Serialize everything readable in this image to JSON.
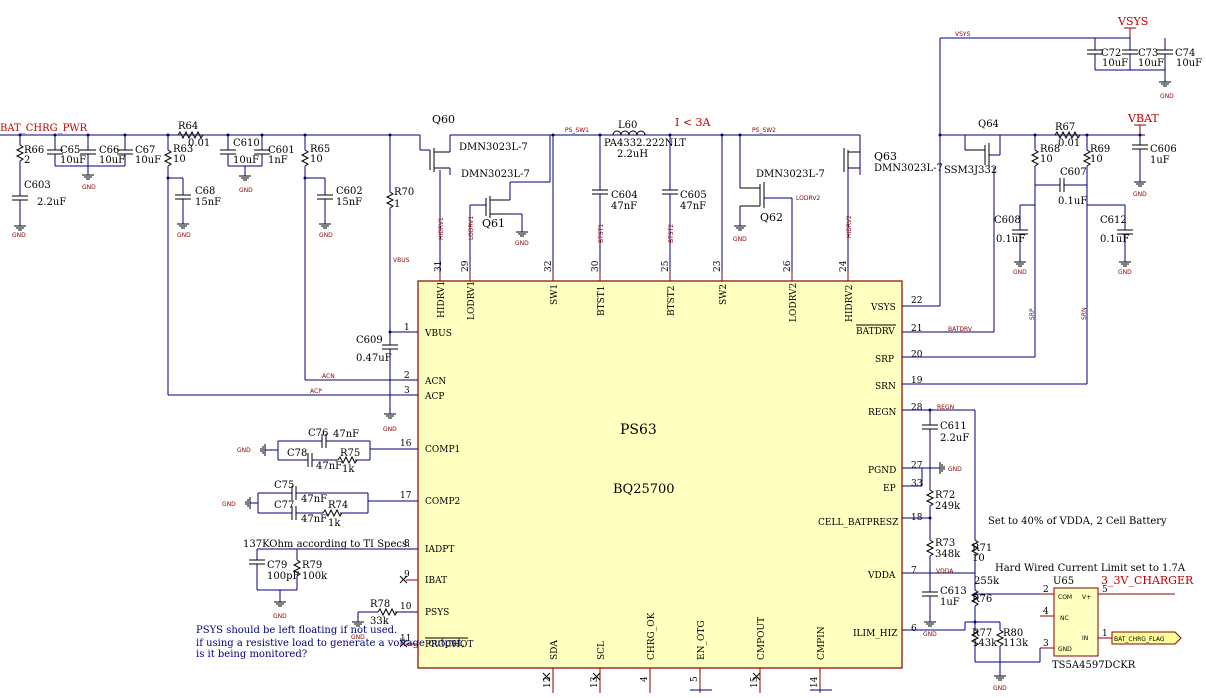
{
  "chip": {
    "designator": "PS63",
    "part": "BQ25700",
    "pins_top": [
      {
        "name": "HIDRV1",
        "num": "31"
      },
      {
        "name": "LODRV1",
        "num": "29"
      },
      {
        "name": "SW1",
        "num": "32"
      },
      {
        "name": "BTST1",
        "num": "30"
      },
      {
        "name": "BTST2",
        "num": "25"
      },
      {
        "name": "SW2",
        "num": "23"
      },
      {
        "name": "LODRV2",
        "num": "26"
      },
      {
        "name": "HIDRV2",
        "num": "24"
      }
    ],
    "pins_left": [
      {
        "name": "VBUS",
        "num": "1"
      },
      {
        "name": "ACN",
        "num": "2"
      },
      {
        "name": "ACP",
        "num": "3"
      },
      {
        "name": "COMP1",
        "num": "16"
      },
      {
        "name": "COMP2",
        "num": "17"
      },
      {
        "name": "IADPT",
        "num": "8"
      },
      {
        "name": "IBAT",
        "num": "9"
      },
      {
        "name": "PSYS",
        "num": "10"
      },
      {
        "name": "PROCHOT",
        "num": "11"
      }
    ],
    "pins_right": [
      {
        "name": "VSYS",
        "num": "22"
      },
      {
        "name": "BATDRV",
        "num": "21"
      },
      {
        "name": "SRP",
        "num": "20"
      },
      {
        "name": "SRN",
        "num": "19"
      },
      {
        "name": "REGN",
        "num": "28"
      },
      {
        "name": "PGND",
        "num": "27"
      },
      {
        "name": "EP",
        "num": "33"
      },
      {
        "name": "CELL_BATPRESZ",
        "num": "18"
      },
      {
        "name": "VDDA",
        "num": "7"
      },
      {
        "name": "ILIM_HIZ",
        "num": "6"
      }
    ],
    "pins_bottom": [
      {
        "name": "SDA",
        "num": "12"
      },
      {
        "name": "SCL",
        "num": "13"
      },
      {
        "name": "CHRG_OK",
        "num": "4"
      },
      {
        "name": "EN_OTG",
        "num": "5"
      },
      {
        "name": "CMPOUT",
        "num": "15"
      },
      {
        "name": "CMPIN",
        "num": "14"
      }
    ]
  },
  "ports": {
    "bat_chrg_pwr": "BAT_CHRG_PWR",
    "vsys": "VSYS",
    "vbat": "VBAT",
    "charger_3v": "3_3V_CHARGER",
    "bat_chrg_flag": "BAT_CHRG_FLAG"
  },
  "nets": {
    "ps_sw1": "PS_SW1",
    "ps_sw2": "PS_SW2",
    "vsys_top": "VSYS",
    "vbus": "VBUS",
    "acn": "ACN",
    "acp": "ACP",
    "hidrv1": "HIDRV1",
    "lodrv1": "LODRV1",
    "btst1": "BTST1",
    "btst2": "BTST2",
    "lodrv2": "LODRV2",
    "hidrv2": "HIDRV2",
    "batdrv": "BATDRV",
    "srp": "SRP",
    "srn": "SRN",
    "regn": "REGN",
    "vdda": "VDDA",
    "gnd": "GND"
  },
  "transistors": [
    {
      "ref": "Q60",
      "part": "DMN3023L-7"
    },
    {
      "ref": "Q61",
      "part": "DMN3023L-7"
    },
    {
      "ref": "Q62",
      "part": "DMN3023L-7"
    },
    {
      "ref": "Q63",
      "part": "DMN3023L-7"
    },
    {
      "ref": "Q64",
      "part": "SSM3J332"
    }
  ],
  "inductor": {
    "ref": "L60",
    "part": "PA4332.222NLT",
    "value": "2.2uH",
    "note": "I < 3A"
  },
  "capacitors": {
    "C65": "10uF",
    "C66": "10uF",
    "C67": "10uF",
    "C603": "2.2uF",
    "C610": "10uF",
    "C601": "1nF",
    "C68": "15nF",
    "C602": "15nF",
    "C604": "47nF",
    "C605": "47nF",
    "C609": "0.47uF",
    "C72": "10uF",
    "C73": "10uF",
    "C74": "10uF",
    "C606": "1uF",
    "C607": "0.1uF",
    "C608": "0.1uF",
    "C612": "0.1uF",
    "C611": "2.2uF",
    "C613": "1uF",
    "C76": "47nF",
    "C78": "47nF",
    "C75": "47nF",
    "C77": "47nF",
    "C79": "100pF"
  },
  "resistors": {
    "R66": "2",
    "R64": "0.01",
    "R63": "10",
    "R65": "10",
    "R70": "1",
    "R67": "0.01",
    "R68": "10",
    "R69": "10",
    "R72": "249k",
    "R73": "348k",
    "R71": "10",
    "R76": "255k",
    "R77": "143k",
    "R80": "113k",
    "R75": "1k",
    "R74": "1k",
    "R79": "100k",
    "R78": "33k"
  },
  "u65": {
    "ref": "U65",
    "part": "TS5A4597DCKR",
    "pins": [
      "COM",
      "V+",
      "NC",
      "IN",
      "GND"
    ],
    "pin_nums": [
      "2",
      "5",
      "4",
      "1",
      "3"
    ]
  },
  "notes": {
    "vdda_note": "Set to 40% of VDDA, 2 Cell Battery",
    "ilim_note": "Hard Wired Current Limit set to 1.7A",
    "iadpt_note": "137KOhm according to TI Specs.",
    "psys_note": "PSYS should be left floating if not used.",
    "psys_note2": "if using a resistive load to generate a voltage output,",
    "psys_note3": "is it being monitored?"
  }
}
